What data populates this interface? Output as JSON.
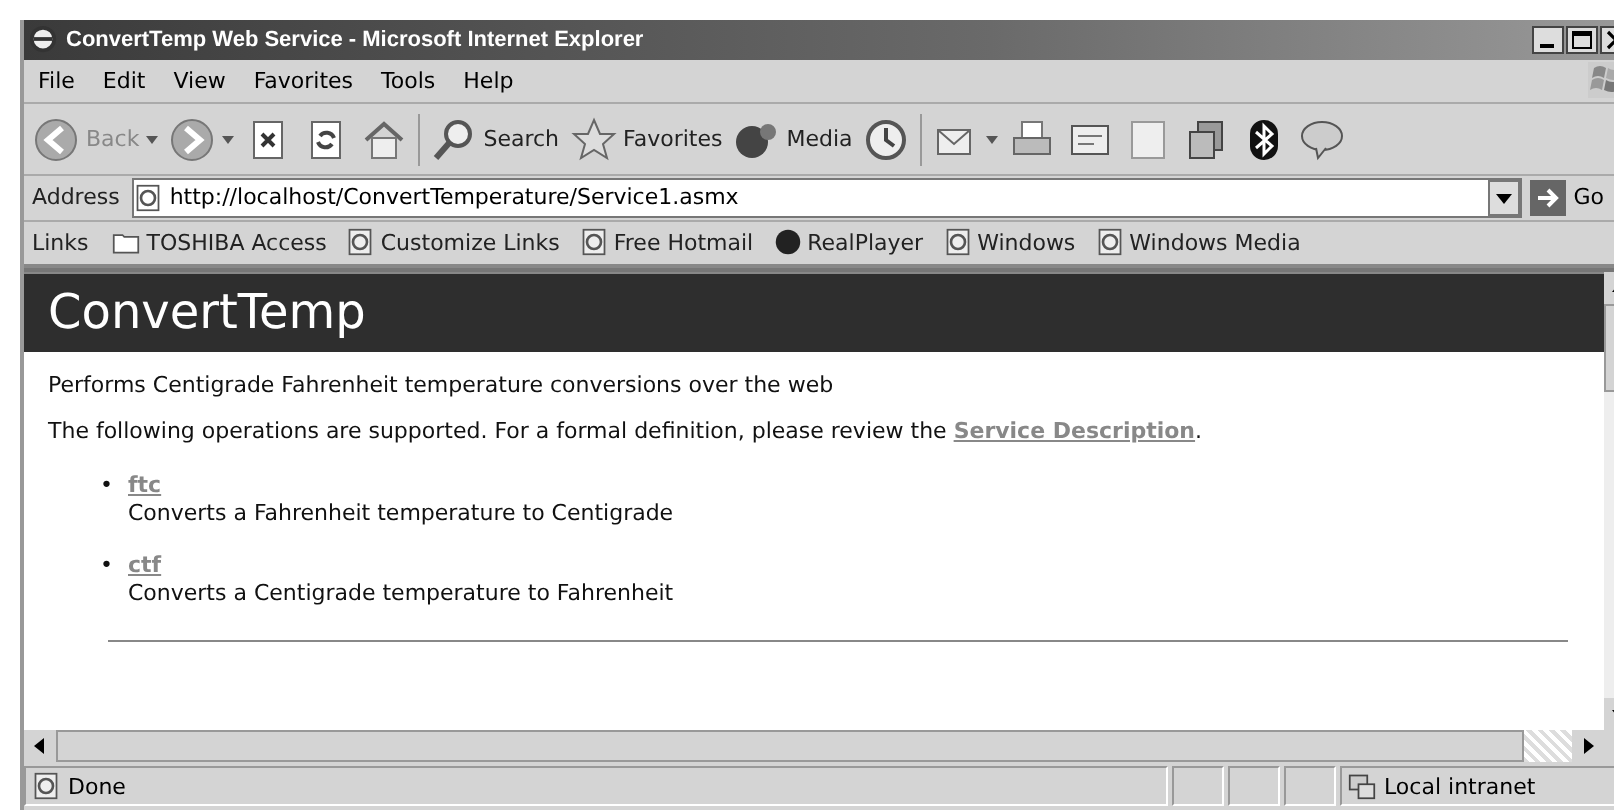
{
  "window": {
    "title": "ConvertTemp Web Service - Microsoft Internet Explorer"
  },
  "menu": [
    "File",
    "Edit",
    "View",
    "Favorites",
    "Tools",
    "Help"
  ],
  "toolbar": [
    {
      "kind": "back",
      "label": "Back"
    },
    {
      "kind": "forward"
    },
    {
      "kind": "stop"
    },
    {
      "kind": "refresh"
    },
    {
      "kind": "home"
    },
    {
      "kind": "search",
      "label": "Search"
    },
    {
      "kind": "favorites",
      "label": "Favorites"
    },
    {
      "kind": "media",
      "label": "Media"
    },
    {
      "kind": "history"
    },
    {
      "kind": "mail"
    },
    {
      "kind": "print"
    },
    {
      "kind": "edit"
    },
    {
      "kind": "page"
    },
    {
      "kind": "messenger"
    },
    {
      "kind": "bluetooth"
    },
    {
      "kind": "chat"
    }
  ],
  "address": {
    "label": "Address",
    "url": "http://localhost/ConvertTemperature/Service1.asmx",
    "go": "Go"
  },
  "links": {
    "label": "Links",
    "items": [
      {
        "kind": "folder",
        "label": "TOSHIBA Access"
      },
      {
        "kind": "page",
        "label": "Customize Links"
      },
      {
        "kind": "page",
        "label": "Free Hotmail"
      },
      {
        "kind": "real",
        "label": "RealPlayer"
      },
      {
        "kind": "page",
        "label": "Windows"
      },
      {
        "kind": "page",
        "label": "Windows Media"
      }
    ]
  },
  "page": {
    "heading": "ConvertTemp",
    "description": "Performs Centigrade Fahrenheit temperature conversions over the web",
    "intro": "The following operations are supported. For a formal definition, please review the ",
    "intro_link": "Service Description",
    "intro_end": ".",
    "operations": [
      {
        "bullet": "•",
        "name": "ftc",
        "description": "Converts a Fahrenheit temperature to Centigrade"
      },
      {
        "bullet": "•",
        "name": "ctf",
        "description": "Converts a Centigrade temperature to Fahrenheit"
      }
    ]
  },
  "status": {
    "text": "Done",
    "zone": "Local intranet"
  }
}
